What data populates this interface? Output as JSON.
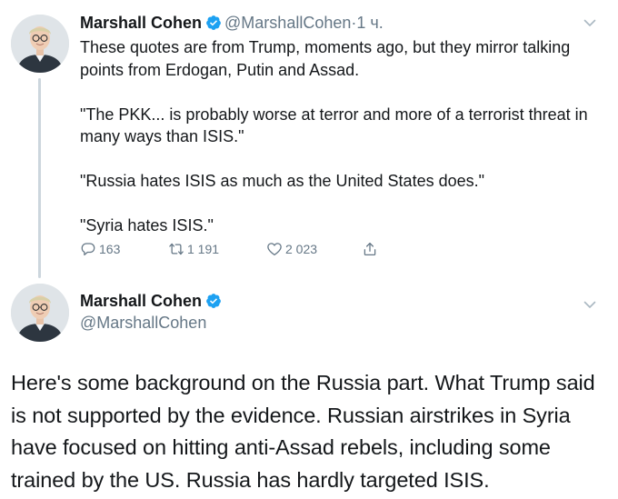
{
  "tweet1": {
    "author_name": "Marshall Cohen",
    "handle": "@MarshallCohen",
    "separator": "·",
    "time": "1 ч.",
    "paragraphs": [
      "These quotes are from Trump, moments ago, but they mirror talking points from Erdogan, Putin and Assad.",
      "\"The PKK... is probably worse at terror and more of a terrorist threat in many ways than ISIS.\"",
      "\"Russia hates ISIS as much as the United States does.\"",
      "\"Syria hates ISIS.\""
    ],
    "replies": "163",
    "retweets": "1 191",
    "likes": "2 023"
  },
  "tweet2": {
    "author_name": "Marshall Cohen",
    "handle": "@MarshallCohen",
    "body_lines": [
      "Here's some background on the Russia part. What Trump said",
      "is not supported by the evidence. Russian airstrikes in Syria",
      "have focused on hitting anti-Assad rebels, including some",
      "trained by the US. Russia has hardly targeted ISIS."
    ]
  },
  "colors": {
    "text": "#14171a",
    "secondary": "#657786",
    "verified": "#1da1f2",
    "thread_line": "#ccd6dd"
  },
  "icons": [
    "avatar",
    "verified-badge-icon",
    "chevron-down-icon",
    "reply-icon",
    "retweet-icon",
    "like-icon",
    "share-icon"
  ]
}
